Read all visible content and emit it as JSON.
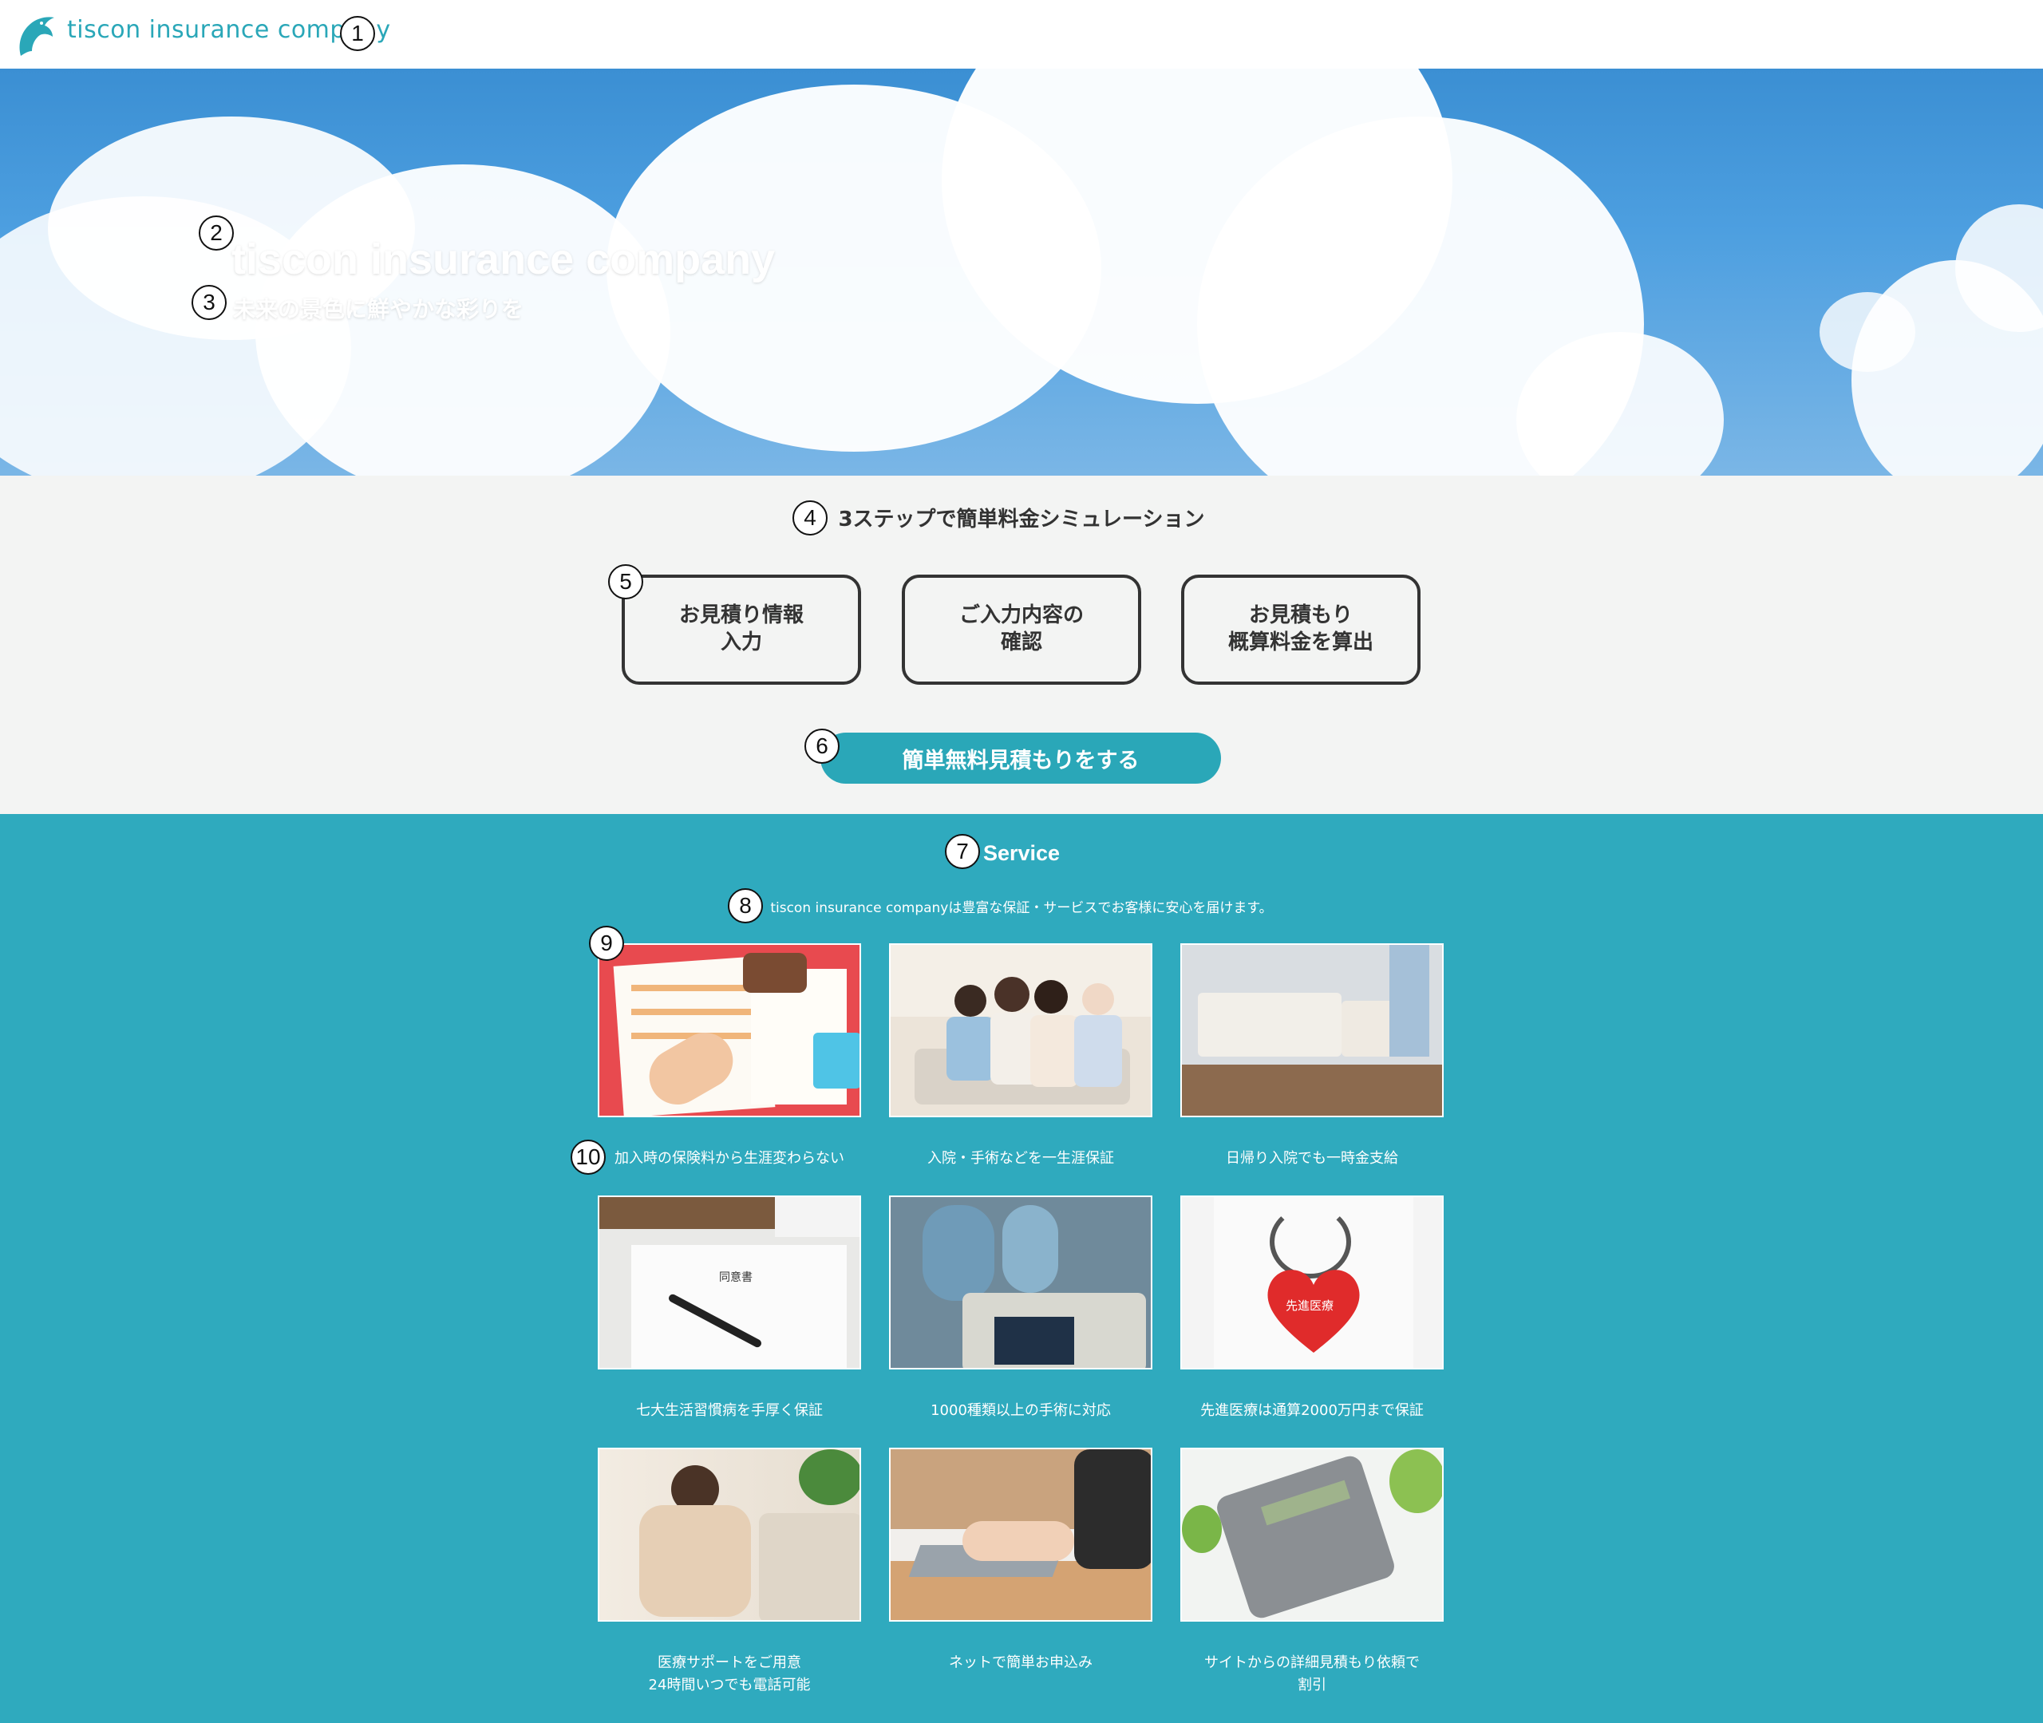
{
  "header": {
    "brand": "tiscon insurance company"
  },
  "hero": {
    "title": "tiscon insurance company",
    "subtitle": "未来の景色に鮮やかな彩りを"
  },
  "steps": {
    "title": "3ステップで簡単料金シミュレーション",
    "items": [
      {
        "line1": "お見積り情報",
        "line2": "入力"
      },
      {
        "line1": "ご入力内容の",
        "line2": "確認"
      },
      {
        "line1": "お見積もり",
        "line2": "概算料金を算出"
      }
    ],
    "cta": "簡単無料見積もりをする"
  },
  "service": {
    "title": "Service",
    "description": "tiscon insurance companyは豊富な保証・サービスでお客様に安心を届けます。",
    "cards": [
      {
        "caption1": "加入時の保険料から生涯変わらない",
        "caption2": ""
      },
      {
        "caption1": "入院・手術などを一生涯保証",
        "caption2": ""
      },
      {
        "caption1": "日帰り入院でも一時金支給",
        "caption2": ""
      },
      {
        "caption1": "七大生活習慣病を手厚く保証",
        "caption2": ""
      },
      {
        "caption1": "1000種類以上の手術に対応",
        "caption2": ""
      },
      {
        "caption1": "先進医療は通算2000万円まで保証",
        "caption2": ""
      },
      {
        "caption1": "医療サポートをご用意",
        "caption2": "24時間いつでも電話可能"
      },
      {
        "caption1": "ネットで簡単お申込み",
        "caption2": ""
      },
      {
        "caption1": "サイトからの詳細見積もり依頼で",
        "caption2": "割引"
      }
    ],
    "heart_label": "先進医療",
    "form_title": "同意書"
  },
  "markers": [
    "1",
    "2",
    "3",
    "4",
    "5",
    "6",
    "7",
    "8",
    "9",
    "10"
  ]
}
